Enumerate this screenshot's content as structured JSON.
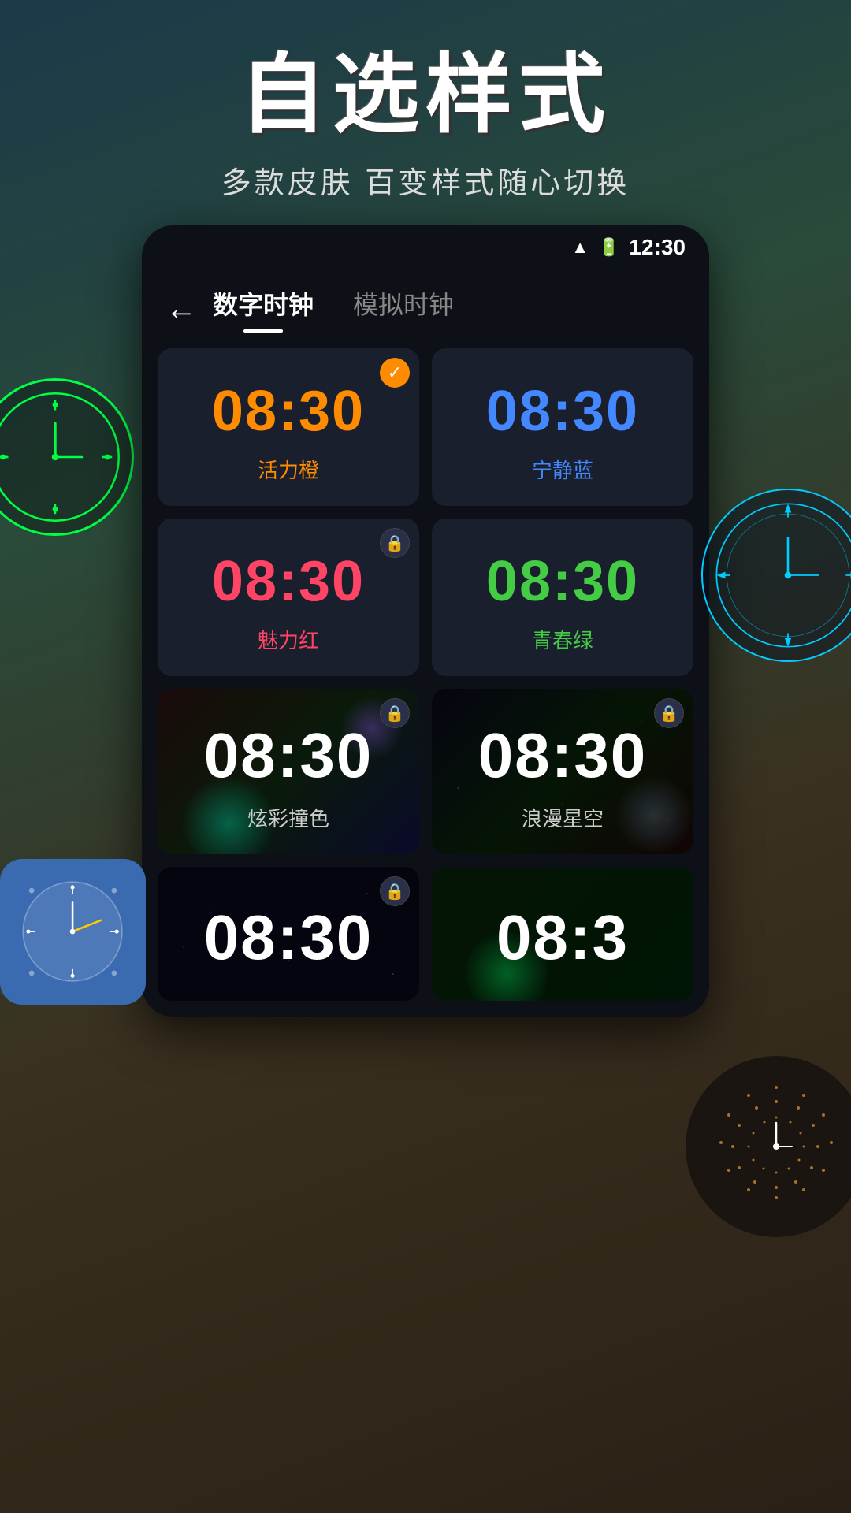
{
  "header": {
    "main_title": "自选样式",
    "sub_title": "多款皮肤 百变样式随心切换"
  },
  "status_bar": {
    "time": "12:30"
  },
  "app_bar": {
    "back_label": "←",
    "tab_digital": "数字时钟",
    "tab_analog": "模拟时钟"
  },
  "clock_cards": [
    {
      "id": "vitality-orange",
      "time": "08:30",
      "label": "活力橙",
      "color": "orange",
      "selected": true,
      "locked": false,
      "dark_bg": false
    },
    {
      "id": "calm-blue",
      "time": "08:30",
      "label": "宁静蓝",
      "color": "blue",
      "selected": false,
      "locked": false,
      "dark_bg": false
    },
    {
      "id": "charm-red",
      "time": "08:30",
      "label": "魅力红",
      "color": "pink",
      "selected": false,
      "locked": true,
      "dark_bg": false
    },
    {
      "id": "youth-green",
      "time": "08:30",
      "label": "青春绿",
      "color": "green",
      "selected": false,
      "locked": false,
      "dark_bg": false
    },
    {
      "id": "dazzle-crash",
      "time": "08:30",
      "label": "炫彩撞色",
      "color": "white",
      "selected": false,
      "locked": true,
      "dark_bg": true,
      "bg_variant": 1
    },
    {
      "id": "romantic-stars",
      "time": "08:30",
      "label": "浪漫星空",
      "color": "white",
      "selected": false,
      "locked": true,
      "dark_bg": true,
      "bg_variant": 2
    },
    {
      "id": "unknown-1",
      "time": "08:30",
      "label": "",
      "color": "white",
      "selected": false,
      "locked": true,
      "dark_bg": true,
      "bg_variant": 3,
      "partial": true
    },
    {
      "id": "unknown-2",
      "time": "08:3",
      "label": "",
      "color": "white",
      "selected": false,
      "locked": false,
      "dark_bg": true,
      "bg_variant": 4,
      "partial": true
    }
  ]
}
